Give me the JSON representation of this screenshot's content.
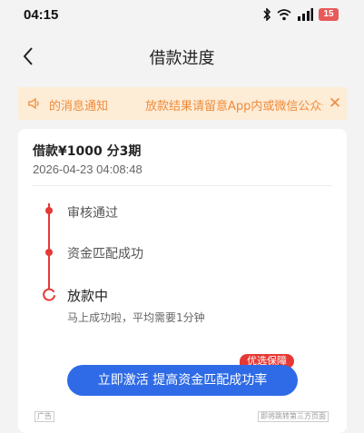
{
  "status_bar": {
    "time": "04:15",
    "battery": "15"
  },
  "nav": {
    "title": "借款进度"
  },
  "notice": {
    "label": "的消息通知",
    "message": "放款结果请留意App内或微信公众号的消"
  },
  "loan": {
    "title": "借款¥1000 分3期",
    "datetime": "2026-04-23 04:08:48"
  },
  "progress": {
    "steps": [
      {
        "label": "审核通过",
        "status": "done"
      },
      {
        "label": "资金匹配成功",
        "status": "done"
      },
      {
        "label": "放款中",
        "status": "current",
        "sub": "马上成功啦，平均需要1分钟"
      }
    ]
  },
  "promo": {
    "badge": "优选保障",
    "button": "立即激活 提高资金匹配成功率",
    "ad_tag": "广告",
    "third_party_tag": "即将跳转第三方页面"
  },
  "colors": {
    "accent_red": "#e53935",
    "button_blue": "#2f6be6",
    "notice_bg": "#fdecd6",
    "notice_text": "#f08b3a"
  }
}
